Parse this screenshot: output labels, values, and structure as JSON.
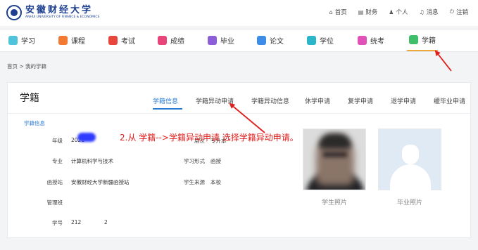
{
  "logo": {
    "name_cn": "安徽财经大学",
    "name_en": "ANHUI UNIVERSITY OF FINANCE & ECONOMICS"
  },
  "toplinks": [
    {
      "icon": "home-icon",
      "label": "首页"
    },
    {
      "icon": "finance-icon",
      "label": "财务"
    },
    {
      "icon": "user-icon",
      "label": "个人"
    },
    {
      "icon": "bell-icon",
      "label": "消息"
    },
    {
      "icon": "logout-icon",
      "label": "注销"
    }
  ],
  "menu": [
    {
      "label": "学习",
      "icon": "study-icon",
      "color": "#4fc3d9"
    },
    {
      "label": "课程",
      "icon": "course-icon",
      "color": "#f27a32"
    },
    {
      "label": "考试",
      "icon": "exam-icon",
      "color": "#e8453c"
    },
    {
      "label": "成绩",
      "icon": "grade-icon",
      "color": "#e8457a"
    },
    {
      "label": "毕业",
      "icon": "graduate-icon",
      "color": "#8c5fd9"
    },
    {
      "label": "论文",
      "icon": "thesis-icon",
      "color": "#3c8de8"
    },
    {
      "label": "学位",
      "icon": "degree-icon",
      "color": "#2bb5c9"
    },
    {
      "label": "统考",
      "icon": "unified-exam-icon",
      "color": "#e052b8"
    },
    {
      "label": "学籍",
      "icon": "status-icon",
      "color": "#3fbf6a"
    }
  ],
  "breadcrumb": "首页 > 我的学籍",
  "page": {
    "title": "学籍",
    "tabs": [
      "学籍信息",
      "学籍异动申请",
      "学籍异动信息",
      "休学申请",
      "复学申请",
      "退学申请",
      "缓毕业申请"
    ],
    "active_tab": "学籍信息",
    "section_label": "学籍信息"
  },
  "fields_left": [
    {
      "label": "年级",
      "value": "2021"
    },
    {
      "label": "专业",
      "value": "计算机科学与技术"
    },
    {
      "label": "函授站",
      "value": "安徽财经大学新疆函授站"
    },
    {
      "label": "管理班",
      "value": ""
    },
    {
      "label": "学号",
      "value": "212"
    }
  ],
  "student_id_tail": "2",
  "fields_right": [
    {
      "label": "层次",
      "value": "专升本"
    },
    {
      "label": "学习形式",
      "value": "函授"
    },
    {
      "label": "学生来源",
      "value": "本校"
    }
  ],
  "photos": {
    "student_caption": "学生照片",
    "graduate_caption": "毕业照片"
  },
  "annotation": "2.从 学籍-->学籍异动申请 选择学籍异动申请。",
  "colors": {
    "accent": "#2b7cd3",
    "annotation": "#e0201e",
    "active_menu_underline": "#f1a83a"
  }
}
